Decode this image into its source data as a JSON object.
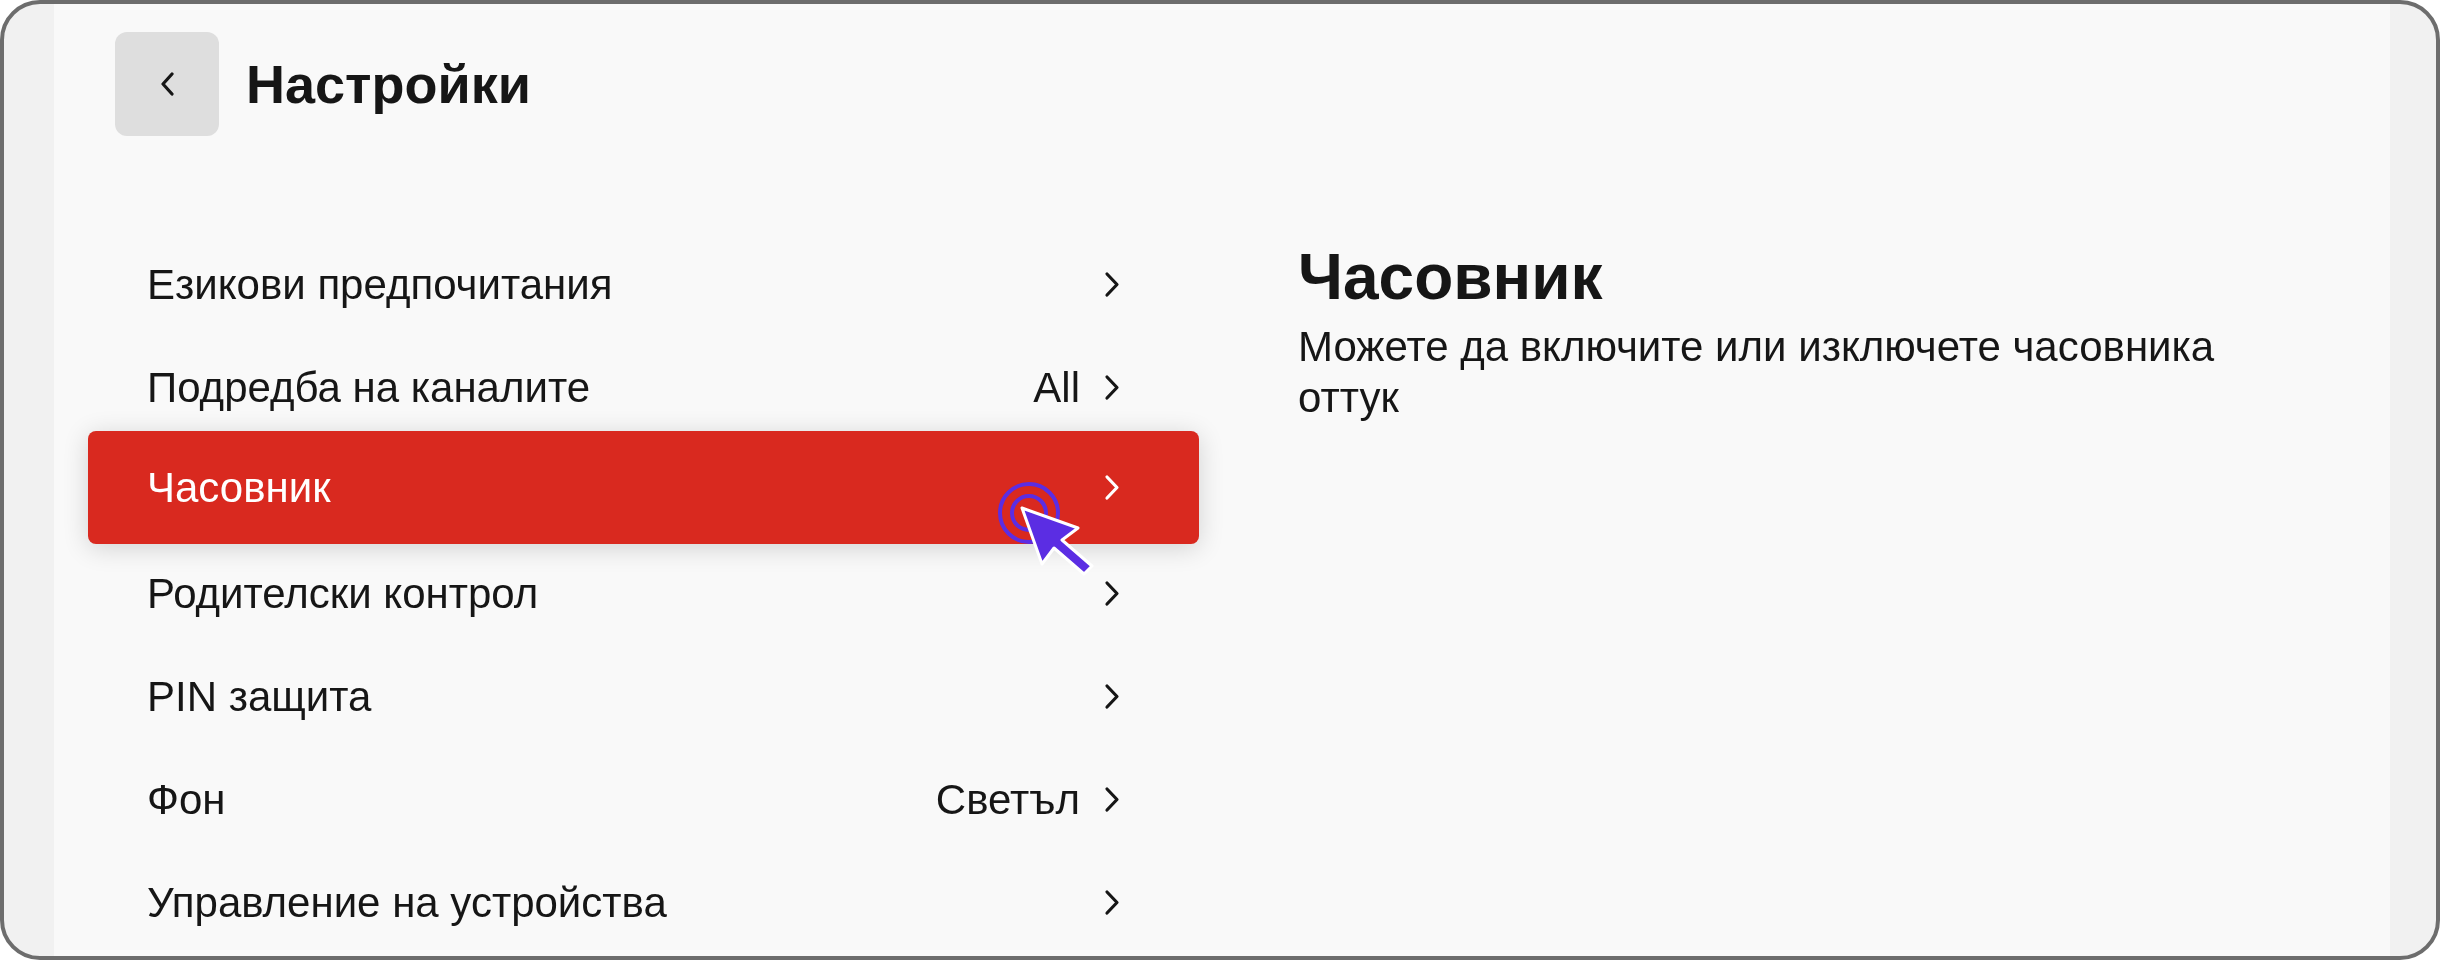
{
  "header": {
    "title": "Настройки"
  },
  "menu": {
    "items": [
      {
        "label": "Езикови предпочитания",
        "selected": false
      },
      {
        "label": "Подредба на каналите",
        "value": "All",
        "selected": false
      },
      {
        "label": "Часовник",
        "selected": true
      },
      {
        "label": "Родителски контрол",
        "selected": false
      },
      {
        "label": "PIN защита",
        "selected": false
      },
      {
        "label": "Фон",
        "value": "Светъл",
        "selected": false
      },
      {
        "label": "Управление на устройства",
        "selected": false
      }
    ]
  },
  "detail": {
    "title": "Часовник",
    "description": "Можете да включите или изключете часовника оттук"
  }
}
